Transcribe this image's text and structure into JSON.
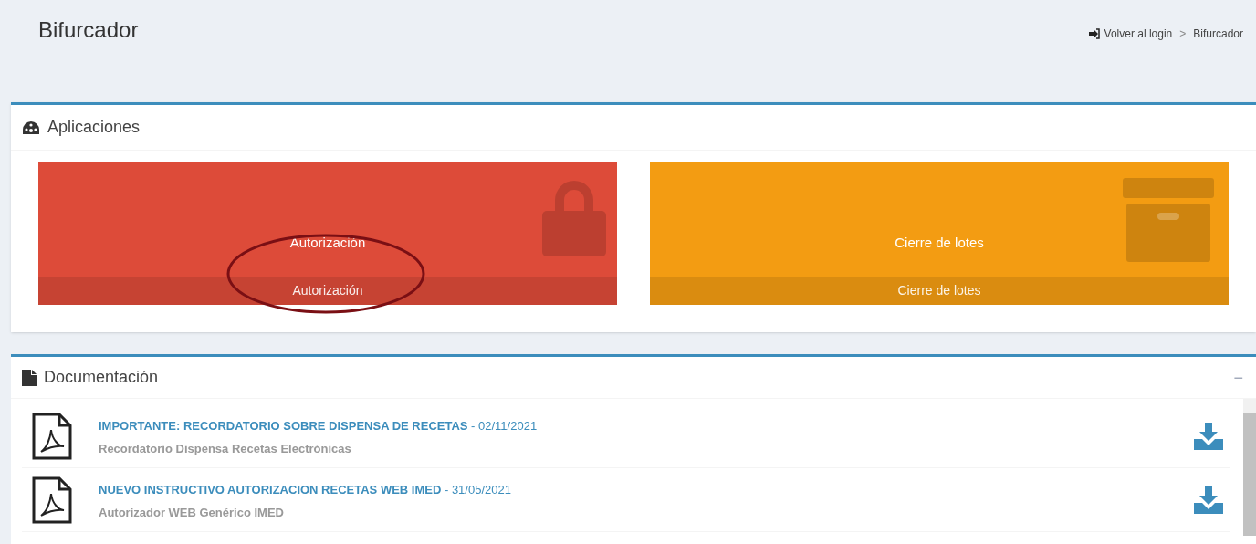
{
  "header": {
    "title": "Bifurcador",
    "breadcrumb_separator": ">",
    "breadcrumb": [
      {
        "label": "Volver al login",
        "kind": "login"
      },
      {
        "label": "Bifurcador",
        "kind": "current"
      }
    ]
  },
  "applications": {
    "title": "Aplicaciones",
    "tiles": [
      {
        "label": "Autorización",
        "footer": "Autorización",
        "kind": "lock",
        "color": "#dd4b39",
        "circled": true
      },
      {
        "label": "Cierre de lotes",
        "footer": "Cierre de lotes",
        "kind": "archive",
        "color": "#f39c12",
        "circled": false
      }
    ]
  },
  "documentation": {
    "title": "Documentación",
    "collapse": "−",
    "documents": [
      {
        "title": "IMPORTANTE: RECORDATORIO SOBRE DISPENSA DE RECETAS",
        "date": " - 02/11/2021",
        "subtitle": "Recordatorio Dispensa Recetas Electrónicas"
      },
      {
        "title": "NUEVO INSTRUCTIVO AUTORIZACION RECETAS WEB IMED",
        "date": " - 31/05/2021",
        "subtitle": "Autorizador WEB Genérico IMED"
      }
    ]
  }
}
